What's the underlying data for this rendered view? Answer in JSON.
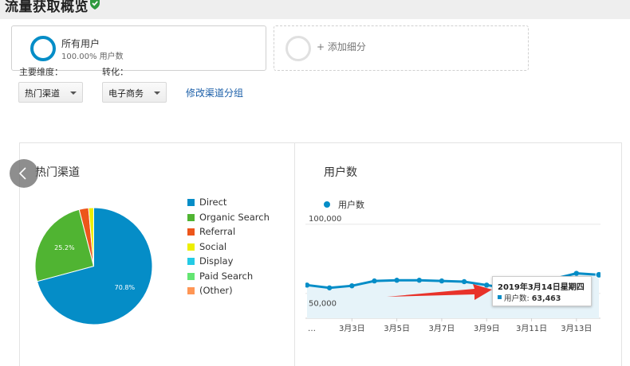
{
  "page": {
    "title": "流量获取概览"
  },
  "segments": {
    "primary": {
      "name": "所有用户",
      "meta": "100.00% 用户数"
    },
    "add_label": "+ 添加细分"
  },
  "controls": {
    "primary_dimension_label": "主要维度：",
    "conversion_label": "转化：",
    "primary_dimension_value": "热门渠道",
    "conversion_value": "电子商务",
    "edit_link": "修改渠道分组"
  },
  "pie_panel": {
    "title": "热门渠道"
  },
  "line_panel": {
    "title": "用户数"
  },
  "tooltip": {
    "date": "2019年3月14日星期四",
    "metric_label": "用户数:",
    "metric_value": "63,463"
  },
  "colors": {
    "accent": "#058dc7",
    "arrow": "#e8322a",
    "link": "#1a5ea8"
  },
  "icons": {
    "verified": "check-badge-icon",
    "nav": "chevron-left-icon"
  },
  "chart_data": [
    {
      "type": "pie",
      "categories": [
        "Direct",
        "Organic Search",
        "Referral",
        "Social",
        "Display",
        "Paid Search",
        "(Other)"
      ],
      "values": [
        70.8,
        25.2,
        2.6,
        1.4,
        0,
        0,
        0
      ],
      "data_labels": [
        "70.8%",
        "25.2%"
      ],
      "colors": [
        "#058dc7",
        "#50b432",
        "#ed561b",
        "#edef00",
        "#24cbe5",
        "#64e572",
        "#ff9655"
      ],
      "legend": "right"
    },
    {
      "type": "area",
      "series": [
        {
          "name": "用户数",
          "color": "#058dc7",
          "x": [
            "3月1日",
            "3月2日",
            "3月3日",
            "3月4日",
            "3月5日",
            "3月6日",
            "3月7日",
            "3月8日",
            "3月9日",
            "3月10日",
            "3月11日",
            "3月12日",
            "3月13日",
            "3月14日"
          ],
          "values": [
            56000,
            54000,
            55500,
            59000,
            59500,
            59500,
            59000,
            58500,
            56000,
            53500,
            60000,
            60500,
            64500,
            63463
          ]
        }
      ],
      "ytick_labels": [
        "50,000",
        "100,000"
      ],
      "ylim": [
        32000,
        108000
      ],
      "xtick_labels": [
        "…",
        "3月3日",
        "3月5日",
        "3月7日",
        "3月9日",
        "3月11日",
        "3月13日"
      ],
      "grid": true
    }
  ]
}
